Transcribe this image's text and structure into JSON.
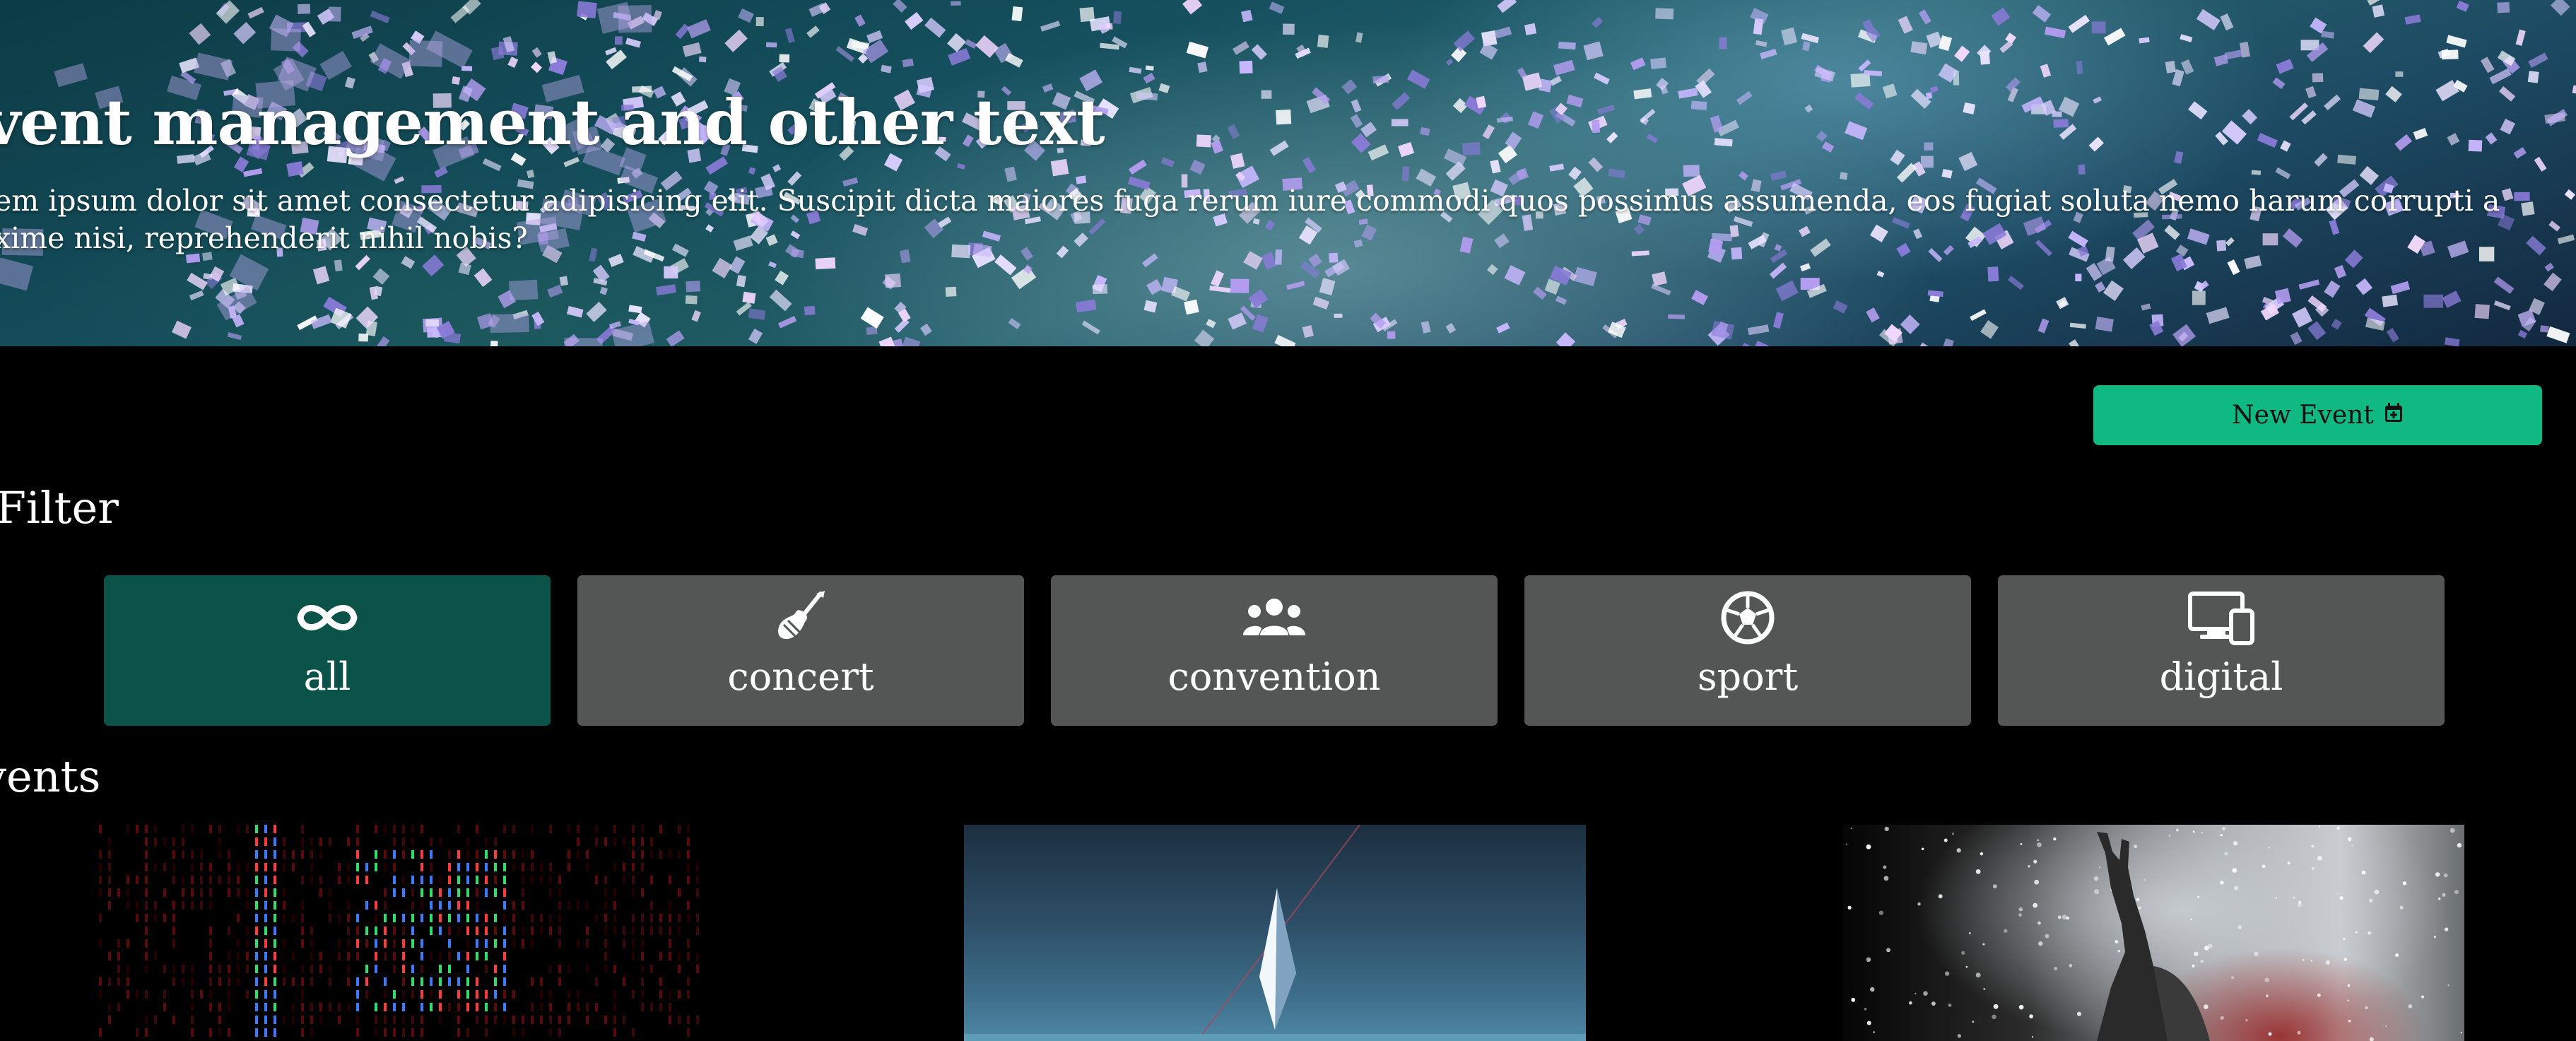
{
  "hero": {
    "title": "vent management and other text",
    "text": "em ipsum dolor sit amet consectetur adipisicing elit. Suscipit dicta maiores fuga rerum iure commodi quos possimus assumenda, eos fugiat soluta nemo harum corrupti a xime nisi, reprehenderit nihil nobis?"
  },
  "actions": {
    "new_event_label": "New Event",
    "new_event_icon": "calendar-plus-icon"
  },
  "filter": {
    "heading": "Filter",
    "items": [
      {
        "label": "all",
        "icon": "infinity-icon",
        "active": true
      },
      {
        "label": "concert",
        "icon": "guitar-icon",
        "active": false
      },
      {
        "label": "convention",
        "icon": "people-group-icon",
        "active": false
      },
      {
        "label": "sport",
        "icon": "soccer-ball-icon",
        "active": false
      },
      {
        "label": "digital",
        "icon": "devices-icon",
        "active": false
      }
    ]
  },
  "events": {
    "heading": "vents",
    "images": [
      "code-screen-image",
      "crystal-pyramid-image",
      "concert-crowd-image"
    ]
  },
  "colors": {
    "accent": "#10b981",
    "filter_active": "#0b5249",
    "filter_inactive": "#545656",
    "background": "#000000"
  }
}
